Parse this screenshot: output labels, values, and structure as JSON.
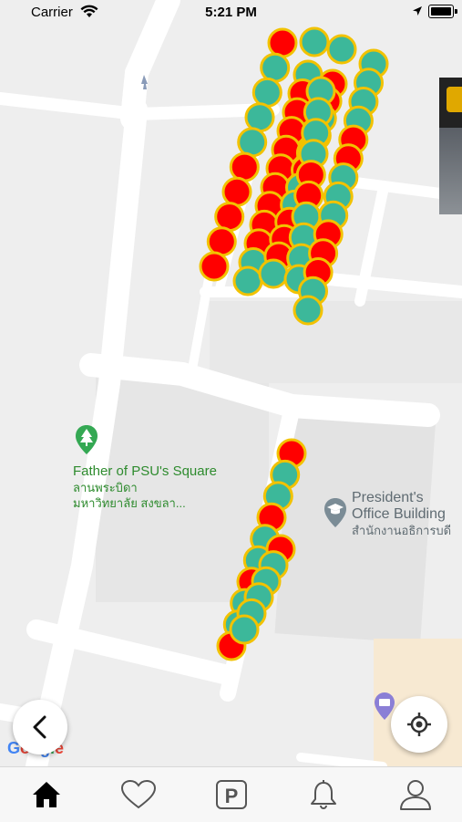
{
  "status_bar": {
    "carrier": "Carrier",
    "time": "5:21 PM"
  },
  "map": {
    "pois": [
      {
        "name": "Father of PSU's Square",
        "sub1": "ลานพระบิดา",
        "sub2": "มหาวิทยาลัย สงขลา...",
        "icon": "tree-pin-icon"
      },
      {
        "name1": "President's",
        "name2": "Office Building",
        "sub": "สำนักงานอธิการบดี",
        "icon": "graduation-pin-icon"
      }
    ],
    "provider_logo": "Google",
    "marker_colors": {
      "occupied": "#ff0000",
      "available": "#3cb89a",
      "border": "#f2c200"
    }
  },
  "tab_bar": {
    "tabs": [
      {
        "icon": "home-icon",
        "active": true
      },
      {
        "icon": "heart-icon",
        "active": false
      },
      {
        "icon": "parking-icon",
        "active": false
      },
      {
        "icon": "bell-icon",
        "active": false
      },
      {
        "icon": "user-icon",
        "active": false
      }
    ],
    "parking_glyph": "P"
  }
}
